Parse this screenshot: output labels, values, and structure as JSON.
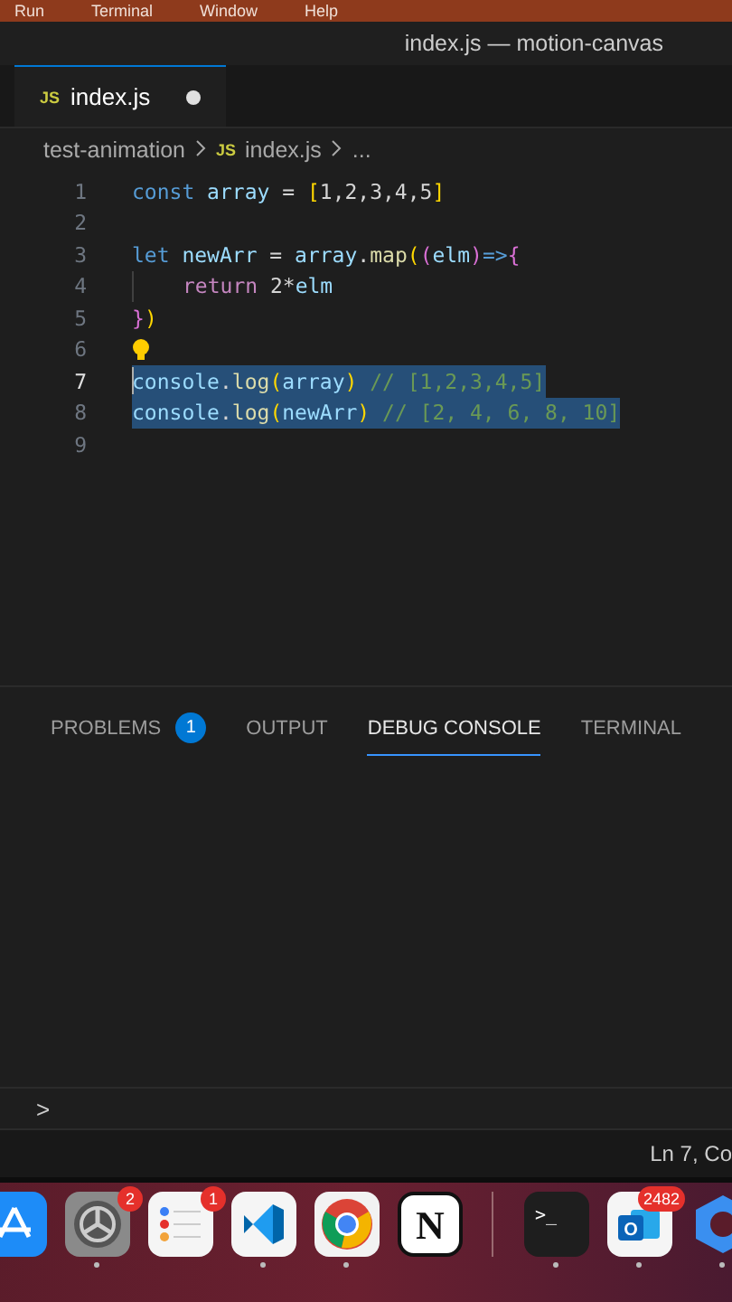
{
  "menu_bar": {
    "items": [
      "Run",
      "Terminal",
      "Window",
      "Help"
    ]
  },
  "window": {
    "title": "index.js — motion-canvas"
  },
  "tabs": [
    {
      "icon_label": "JS",
      "label": "index.js",
      "selected": true,
      "modified": true
    }
  ],
  "breadcrumb": {
    "folder": "test-animation",
    "icon_label": "JS",
    "file": "index.js",
    "more": "..."
  },
  "editor": {
    "lines": [
      {
        "number": "1",
        "selected": false,
        "tokens": [
          {
            "text": "const",
            "kind": "keyword"
          },
          {
            "text": " array",
            "kind": "variable"
          },
          {
            "text": " = ",
            "kind": "plain"
          },
          {
            "text": "[",
            "kind": "bracket1"
          },
          {
            "text": "1,2,3,4,5",
            "kind": "plain"
          },
          {
            "text": "]",
            "kind": "bracket1"
          }
        ]
      },
      {
        "number": "2",
        "selected": false
      },
      {
        "number": "3",
        "selected": false,
        "tokens": [
          {
            "text": "let",
            "kind": "keyword"
          },
          {
            "text": " newArr",
            "kind": "variable"
          },
          {
            "text": " = ",
            "kind": "plain"
          },
          {
            "text": "array",
            "kind": "variable"
          },
          {
            "text": ".",
            "kind": "plain"
          },
          {
            "text": "map",
            "kind": "function"
          },
          {
            "text": "(",
            "kind": "bracket1"
          },
          {
            "text": "(",
            "kind": "bracket2"
          },
          {
            "text": "elm",
            "kind": "variable"
          },
          {
            "text": ")",
            "kind": "bracket2"
          },
          {
            "text": "=>",
            "kind": "keyword"
          },
          {
            "text": "{",
            "kind": "bracket2"
          }
        ]
      },
      {
        "number": "4",
        "selected": false,
        "indent": true,
        "tokens": [
          {
            "text": "return",
            "kind": "control"
          },
          {
            "text": " 2*",
            "kind": "plain"
          },
          {
            "text": "elm",
            "kind": "variable"
          }
        ]
      },
      {
        "number": "5",
        "selected": false,
        "tokens": [
          {
            "text": "}",
            "kind": "bracket2"
          },
          {
            "text": ")",
            "kind": "bracket1"
          }
        ]
      },
      {
        "number": "6",
        "selected": false,
        "lightbulb": true
      },
      {
        "number": "7",
        "selected": true,
        "cursor": true,
        "tokens": [
          {
            "text": "console",
            "kind": "variable"
          },
          {
            "text": ".",
            "kind": "plain"
          },
          {
            "text": "log",
            "kind": "function"
          },
          {
            "text": "(",
            "kind": "bracket1"
          },
          {
            "text": "array",
            "kind": "variable"
          },
          {
            "text": ")",
            "kind": "bracket1"
          },
          {
            "text": " // [1,2,3,4,5]",
            "kind": "comment"
          }
        ]
      },
      {
        "number": "8",
        "selected": true,
        "tokens": [
          {
            "text": "console",
            "kind": "variable"
          },
          {
            "text": ".",
            "kind": "plain"
          },
          {
            "text": "log",
            "kind": "function"
          },
          {
            "text": "(",
            "kind": "bracket1"
          },
          {
            "text": "newArr",
            "kind": "variable"
          },
          {
            "text": ")",
            "kind": "bracket1"
          },
          {
            "text": " // [2, 4, 6, 8, 10]",
            "kind": "comment"
          }
        ]
      },
      {
        "number": "9",
        "selected": false
      }
    ]
  },
  "panel": {
    "tabs": [
      {
        "label": "PROBLEMS",
        "badge": "1",
        "selected": false
      },
      {
        "label": "OUTPUT",
        "selected": false
      },
      {
        "label": "DEBUG CONSOLE",
        "selected": true
      },
      {
        "label": "TERMINAL",
        "selected": false
      }
    ],
    "prompt": ">"
  },
  "status_bar": {
    "position": "Ln 7, Co"
  },
  "dock": {
    "items": [
      {
        "kind": "appstore",
        "running": false
      },
      {
        "kind": "settings",
        "badge": "2",
        "running": true
      },
      {
        "kind": "reminders",
        "badge": "1",
        "running": false
      },
      {
        "kind": "vscode",
        "running": true
      },
      {
        "kind": "chrome",
        "running": true
      },
      {
        "kind": "notion",
        "glyph": "N",
        "running": false
      },
      {
        "kind": "divider"
      },
      {
        "kind": "terminal",
        "glyph": ">_",
        "running": true
      },
      {
        "kind": "outlook",
        "glyph": "O",
        "badge": "2482",
        "running": true
      },
      {
        "kind": "hub",
        "running": true
      }
    ]
  }
}
